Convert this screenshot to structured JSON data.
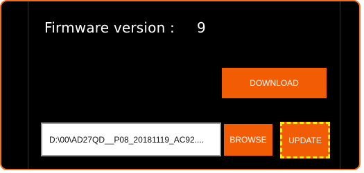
{
  "firmware": {
    "label": "Firmware version :",
    "value": "9"
  },
  "buttons": {
    "download_label": "DOWNLOAD",
    "browse_label": "BROWSE",
    "update_label": "UPDATE"
  },
  "file": {
    "path_value": "D:\\00\\AD27QD__P08_20181119_AC92...."
  },
  "colors": {
    "accent": "#f25c05",
    "frame_border": "#f07020",
    "focus_dashed": "#ffea00",
    "background": "#000000"
  }
}
